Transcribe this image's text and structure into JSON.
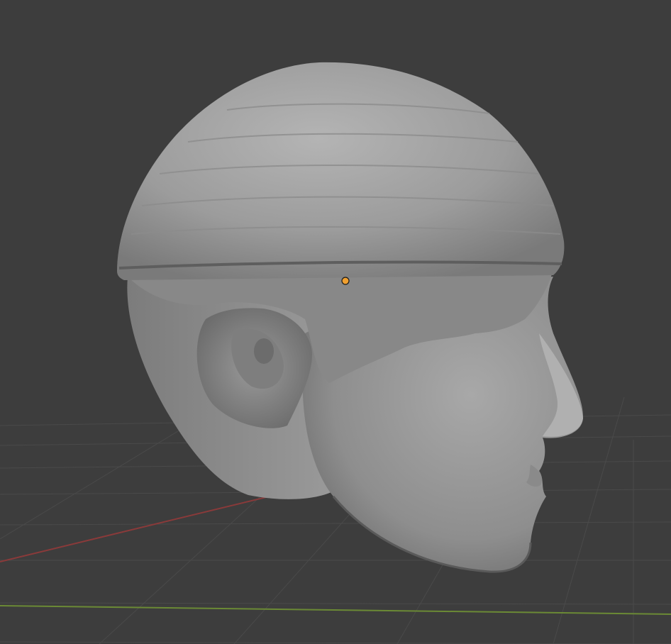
{
  "viewport": {
    "mode": "3d-viewport",
    "background_color": "#3d3d3d",
    "grid_color": "#4a4a4a",
    "x_axis_color": "#8a3a3a",
    "y_axis_color": "#6b8a35",
    "origin_color": "#f0a030",
    "mesh_color": "#9a9a9a"
  },
  "object": {
    "name": "",
    "icon": "mesh-head-object",
    "selected": false
  }
}
